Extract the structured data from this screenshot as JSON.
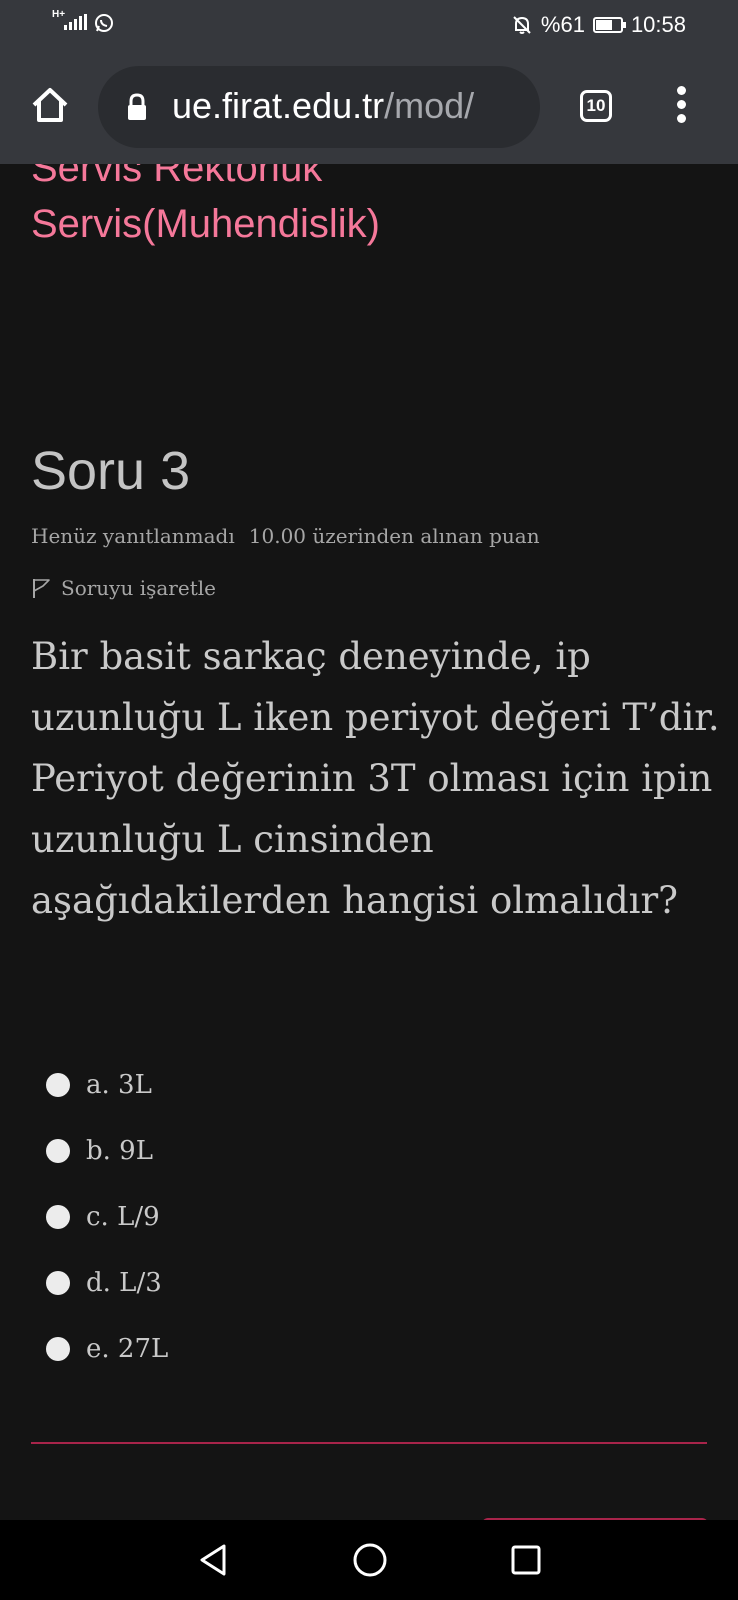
{
  "status_bar": {
    "network": "H+",
    "battery_text": "%61",
    "battery_level": 0.61,
    "time": "10:58"
  },
  "browser": {
    "url_domain": "ue.firat.edu.tr",
    "url_path": "/mod/",
    "tab_count": "10"
  },
  "page": {
    "prev_text_line1": "Servis Rektörlük",
    "prev_text_line2": "Servis(Muhendislik)",
    "question": {
      "title": "Soru 3",
      "status": "Henüz yanıtlanmadı",
      "grade": "10.00 üzerinden alınan puan",
      "flag_label": "Soruyu işaretle",
      "text": "Bir basit sarkaç deneyinde, ip uzunluğu L iken periyot değeri T’dir. Periyot değerinin 3T olması için ipin uzunluğu L cinsinden aşağıdakilerden hangisi olmalıdır?",
      "answers": [
        {
          "label": "a. 3L"
        },
        {
          "label": "b. 9L"
        },
        {
          "label": "c. L/9"
        },
        {
          "label": "d. L/3"
        },
        {
          "label": "e. 27L"
        }
      ]
    }
  },
  "colors": {
    "accent": "#f5789a",
    "divider": "#a8244a",
    "background": "#141414"
  }
}
